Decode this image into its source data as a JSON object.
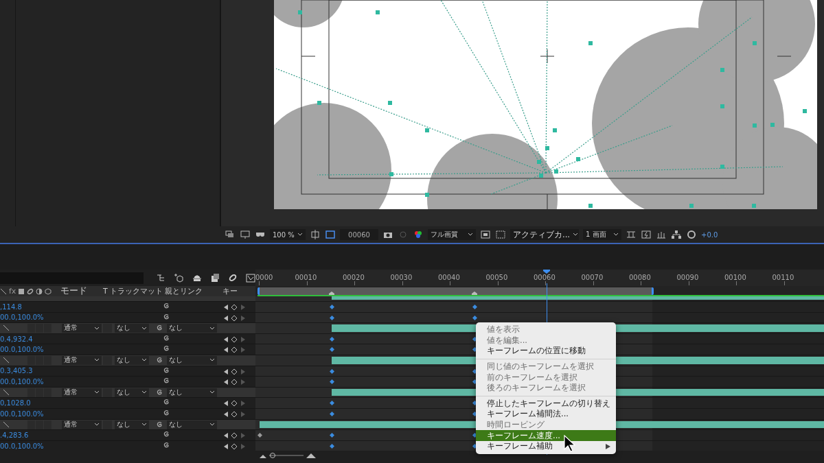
{
  "viewer_toolbar": {
    "zoom": "100 %",
    "timecode": "00060",
    "quality": "フル画質",
    "camera": "アクティブカ...",
    "views": "1 画面",
    "exposure": "+0.0"
  },
  "timeline": {
    "ruler": [
      "0000",
      "00010",
      "00020",
      "00030",
      "00040",
      "00050",
      "00060",
      "00070",
      "00080",
      "00090",
      "00100",
      "00110"
    ],
    "switch_label": "fx",
    "zoom": {
      "level": 0.1
    },
    "columns": [
      "モード",
      "T",
      "トラックマット",
      "親とリンク",
      "キー"
    ],
    "rows": [
      {
        "kind": "partial"
      },
      {
        "kind": "property",
        "value": ",114.8"
      },
      {
        "kind": "property",
        "value": "00.0,100.0%"
      },
      {
        "kind": "layer",
        "mode": "通常",
        "matte": "なし",
        "parent": "なし"
      },
      {
        "kind": "property",
        "value": "0.4,932.4"
      },
      {
        "kind": "property",
        "value": "00.0,100.0%"
      },
      {
        "kind": "layer",
        "mode": "通常",
        "matte": "なし",
        "parent": "なし"
      },
      {
        "kind": "property",
        "value": "0.3,405.3"
      },
      {
        "kind": "property",
        "value": "00.0,100.0%"
      },
      {
        "kind": "layer",
        "mode": "通常",
        "matte": "なし",
        "parent": "なし"
      },
      {
        "kind": "property",
        "value": "0,1028.0"
      },
      {
        "kind": "property",
        "value": "00.0,100.0%"
      },
      {
        "kind": "layer",
        "mode": "通常",
        "matte": "なし",
        "parent": "なし"
      },
      {
        "kind": "property",
        "value": ".4,283.6"
      },
      {
        "kind": "property",
        "value": "00.0,100.0%"
      }
    ]
  },
  "menu": {
    "groups": [
      [
        {
          "label": "値を表示",
          "disabled": true,
          "selected": false,
          "submenu": false
        },
        {
          "label": "値を編集...",
          "disabled": true,
          "selected": false,
          "submenu": false
        },
        {
          "label": "キーフレームの位置に移動",
          "disabled": false,
          "selected": false,
          "submenu": false
        }
      ],
      [
        {
          "label": "同じ値のキーフレームを選択",
          "disabled": true,
          "selected": false,
          "submenu": false
        },
        {
          "label": "前のキーフレームを選択",
          "disabled": true,
          "selected": false,
          "submenu": false
        },
        {
          "label": "後ろのキーフレームを選択",
          "disabled": true,
          "selected": false,
          "submenu": false
        }
      ],
      [
        {
          "label": "停止したキーフレームの切り替え",
          "disabled": false,
          "selected": false,
          "submenu": false
        },
        {
          "label": "キーフレーム補間法...",
          "disabled": false,
          "selected": false,
          "submenu": false
        },
        {
          "label": "時間ロービング",
          "disabled": true,
          "selected": false,
          "submenu": false
        },
        {
          "label": "キーフレーム速度...",
          "disabled": false,
          "selected": true,
          "submenu": false
        },
        {
          "label": "キーフレーム補助",
          "disabled": false,
          "selected": false,
          "submenu": true
        }
      ]
    ]
  }
}
